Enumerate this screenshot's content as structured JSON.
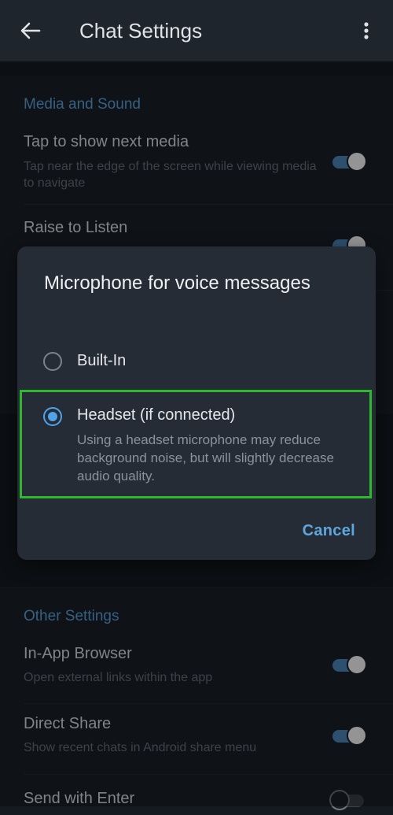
{
  "appbar": {
    "title": "Chat Settings",
    "back_icon": "arrow-left-icon",
    "more_icon": "more-vertical-icon"
  },
  "media_section": {
    "header": "Media and Sound",
    "items": [
      {
        "title": "Tap to show next media",
        "subtitle": "Tap near the edge of the screen while viewing media to navigate",
        "enabled": true
      },
      {
        "title": "Raise to Listen",
        "enabled": true
      }
    ]
  },
  "dialog": {
    "title": "Microphone for voice messages",
    "options": [
      {
        "label": "Built-In",
        "selected": false
      },
      {
        "label": "Headset (if connected)",
        "description": "Using a headset microphone may reduce background noise, but will slightly decrease audio quality.",
        "selected": true
      }
    ],
    "cancel_label": "Cancel"
  },
  "other_section": {
    "header": "Other Settings",
    "items": [
      {
        "title": "In-App Browser",
        "subtitle": "Open external links within the app",
        "enabled": true
      },
      {
        "title": "Direct Share",
        "subtitle": "Show recent chats in Android share menu",
        "enabled": true
      },
      {
        "title": "Send with Enter",
        "enabled": false
      }
    ]
  },
  "colors": {
    "accent": "#4fa3ea",
    "highlight": "#2eb82e",
    "background": "#151a21"
  }
}
